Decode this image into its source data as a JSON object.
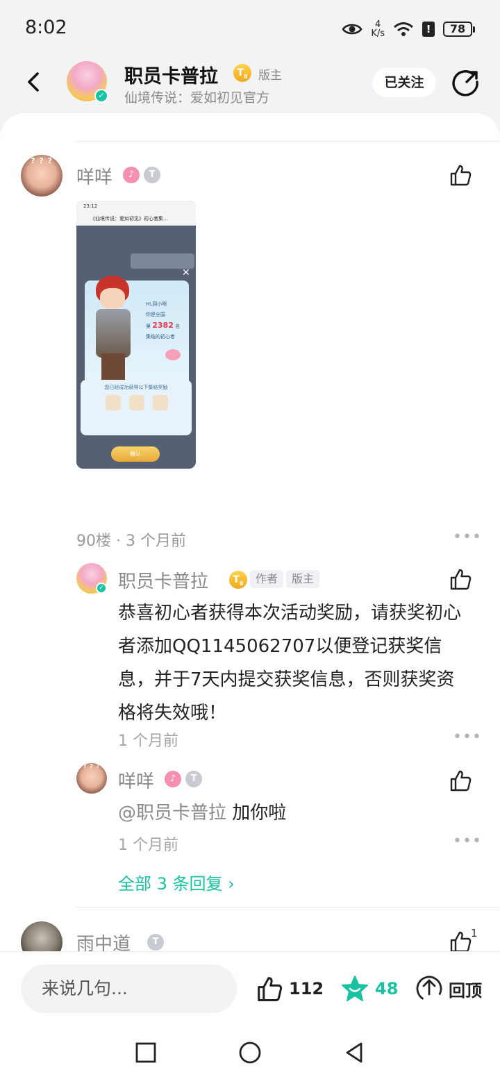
{
  "status_bar": {
    "time": "8:02",
    "net_speed_value": "4",
    "net_speed_unit": "K/s",
    "battery": "78",
    "icons": [
      "eye-icon",
      "wifi-icon",
      "alert-icon",
      "battery-icon"
    ]
  },
  "header": {
    "name": "职员卡普拉",
    "level": "T",
    "level_sub": "8",
    "role": "版主",
    "subtitle": "仙境传说：爱如初见官方",
    "follow_label": "已关注"
  },
  "post": {
    "user": {
      "name": "咩咩",
      "avatar_text": "? ? ?",
      "badge1": "♪",
      "badge2": "T",
      "badge2_sub": "1"
    },
    "screenshot": {
      "status_time": "23:12",
      "title": "《仙境传说：爱如初见》初心者集...",
      "greeting": "Hi,到小咪",
      "line1": "你是全国",
      "rank_prefix": "第",
      "rank": "2382",
      "rank_suffix": "名",
      "line3": "集结的初心者",
      "reward_title": "您已经成功获得以下集结奖励",
      "confirm": "确认"
    },
    "floor": "90楼",
    "time_ago": "3 个月前"
  },
  "replies": [
    {
      "name": "职员卡普拉",
      "level": "T",
      "level_sub": "8",
      "tag_author": "作者",
      "tag_mod": "版主",
      "text": "恭喜初心者获得本次活动奖励，请获奖初心者添加QQ1145062707以便登记获奖信息，并于7天内提交获奖信息，否则获奖资格将失效哦！",
      "time": "1 个月前"
    },
    {
      "name": "咩咩",
      "mention": "@职员卡普拉",
      "text": "加你啦",
      "time": "1 个月前"
    }
  ],
  "see_all": "全部 3 条回复 ›",
  "next_post": {
    "name": "雨中道",
    "badge": "T",
    "badge_sub": "1",
    "like_count": "1"
  },
  "bottom_bar": {
    "input_placeholder": "来说几句...",
    "likes": "112",
    "stars": "48",
    "top_label": "回顶"
  },
  "colors": {
    "accent": "#19c2a0",
    "background": "#f2f3f5",
    "rank_red": "#e23a52"
  }
}
